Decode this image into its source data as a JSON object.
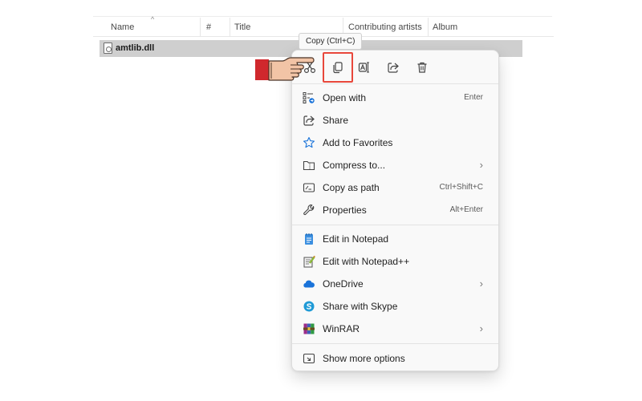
{
  "file_list": {
    "columns": [
      "Name",
      "#",
      "Title",
      "Contributing artists",
      "Album"
    ],
    "file_name": "amtlib.dll"
  },
  "tooltip": "Copy (Ctrl+C)",
  "quick_actions": [
    "cut-icon",
    "copy-icon",
    "rename-icon",
    "share-icon",
    "delete-icon"
  ],
  "menu": {
    "group1": [
      {
        "label": "Open with",
        "shortcut": "Enter",
        "icon": "open-with-icon"
      },
      {
        "label": "Share",
        "shortcut": "",
        "icon": "share-icon"
      },
      {
        "label": "Add to Favorites",
        "shortcut": "",
        "icon": "star-icon"
      },
      {
        "label": "Compress to...",
        "shortcut": "",
        "icon": "zip-folder-icon",
        "submenu": true
      },
      {
        "label": "Copy as path",
        "shortcut": "Ctrl+Shift+C",
        "icon": "copy-path-icon"
      },
      {
        "label": "Properties",
        "shortcut": "Alt+Enter",
        "icon": "wrench-icon"
      }
    ],
    "group2": [
      {
        "label": "Edit in Notepad",
        "icon": "notepad-icon"
      },
      {
        "label": "Edit with Notepad++",
        "icon": "notepad-plus-icon"
      },
      {
        "label": "OneDrive",
        "icon": "onedrive-icon",
        "submenu": true
      },
      {
        "label": "Share with Skype",
        "icon": "skype-icon"
      },
      {
        "label": "WinRAR",
        "icon": "winrar-icon",
        "submenu": true
      }
    ],
    "group3": [
      {
        "label": "Show more options",
        "icon": "show-more-icon"
      }
    ],
    "chevron": "›"
  },
  "colors": {
    "highlight": "#e8473b",
    "onedrive": "#1a73d9",
    "skype": "#1f9ad6",
    "notepad": "#3b8fe0",
    "hand_cuff": "#d0282d"
  }
}
